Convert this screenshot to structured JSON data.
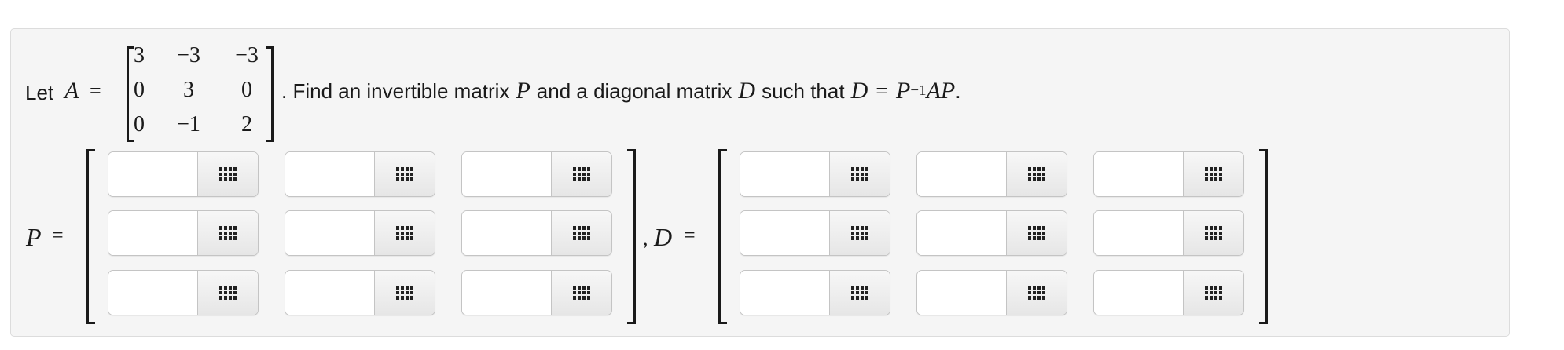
{
  "prompt": {
    "let": "Let",
    "A_var": "A",
    "equals": "=",
    "sentence_part1": ". Find an invertible matrix",
    "P_var": "P",
    "and_text": "and a diagonal matrix",
    "D_var": "D",
    "such_that": "such that",
    "equation_lhs": "D",
    "equation_eq": "=",
    "equation_P": "P",
    "equation_exp": "−1",
    "equation_AP": "AP",
    "period": "."
  },
  "matrix_A": [
    [
      "3",
      "−3",
      "−3"
    ],
    [
      "0",
      "3",
      "0"
    ],
    [
      "0",
      "−1",
      "2"
    ]
  ],
  "answer": {
    "P_label": "P",
    "P_eq": "=",
    "comma": ",",
    "D_label": "D",
    "D_eq": "=",
    "P_values": [
      [
        "",
        "",
        ""
      ],
      [
        "",
        "",
        ""
      ],
      [
        "",
        "",
        ""
      ]
    ],
    "D_values": [
      [
        "",
        "",
        ""
      ],
      [
        "",
        "",
        ""
      ],
      [
        "",
        "",
        ""
      ]
    ],
    "button_icon": "keypad-grid-icon"
  }
}
